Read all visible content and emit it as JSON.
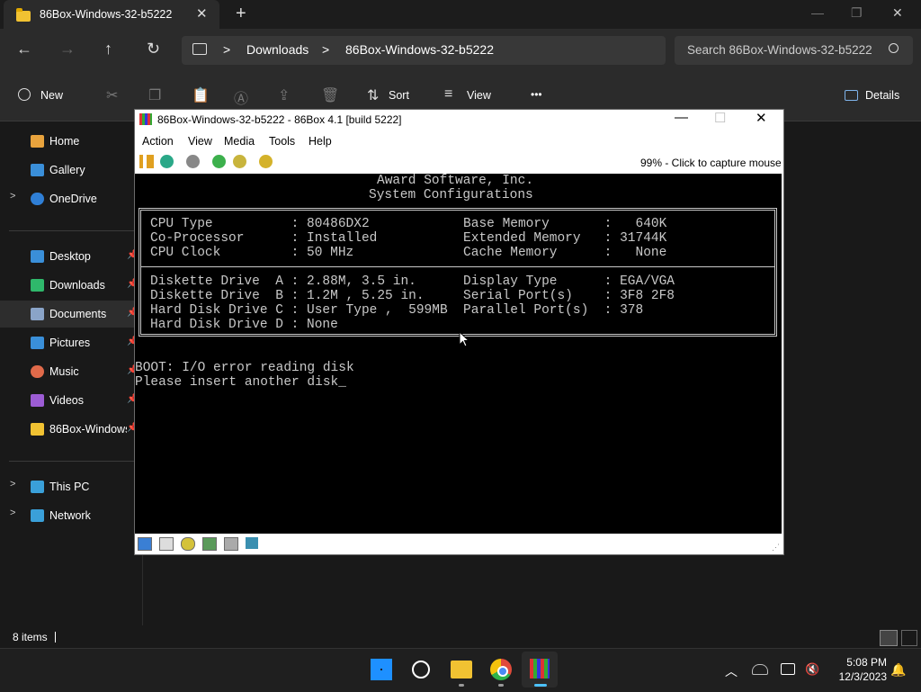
{
  "explorer": {
    "tab_title": "86Box-Windows-32-b5222",
    "tab_close": "✕",
    "new_tab": "+",
    "window_controls": {
      "minimize": "—",
      "maximize": "❐",
      "close": "✕"
    },
    "nav": {
      "back": "←",
      "forward": "→",
      "up": "↑",
      "refresh": "↻"
    },
    "breadcrumb": [
      "Downloads",
      "86Box-Windows-32-b5222"
    ],
    "breadcrumb_sep": ">",
    "search_placeholder": "Search 86Box-Windows-32-b5222",
    "commands": {
      "new": "New",
      "sort": "Sort",
      "view": "View",
      "more": "•••",
      "details": "Details"
    },
    "sidebar": {
      "items": [
        {
          "label": "Home",
          "icon": "home-icon",
          "color": "#e8a33d"
        },
        {
          "label": "Gallery",
          "icon": "gallery-icon",
          "color": "#3a8fd9"
        },
        {
          "label": "OneDrive",
          "icon": "cloud-icon",
          "color": "#2f7fd6"
        },
        {
          "label": "Desktop",
          "icon": "desktop-icon",
          "color": "#3a8fd9"
        },
        {
          "label": "Downloads",
          "icon": "download-icon",
          "color": "#2fb86b"
        },
        {
          "label": "Documents",
          "icon": "document-icon",
          "color": "#8aa4c8"
        },
        {
          "label": "Pictures",
          "icon": "pictures-icon",
          "color": "#3a8fd9"
        },
        {
          "label": "Music",
          "icon": "music-icon",
          "color": "#e06a4a"
        },
        {
          "label": "Videos",
          "icon": "videos-icon",
          "color": "#9c5cd4"
        },
        {
          "label": "86Box-Windows",
          "icon": "folder-icon",
          "color": "#f1c232"
        },
        {
          "label": "This PC",
          "icon": "pc-icon",
          "color": "#3aa0d9"
        },
        {
          "label": "Network",
          "icon": "network-icon",
          "color": "#3aa0d9"
        }
      ]
    },
    "status_items": "8 items"
  },
  "box86": {
    "title": "86Box-Windows-32-b5222 - 86Box 4.1 [build 5222]",
    "menu": [
      "Action",
      "View",
      "Media",
      "Tools",
      "Help"
    ],
    "capture_text": "99% - Click to capture mouse",
    "screen": {
      "header1": "Award Software, Inc.",
      "header2": "System Configurations",
      "rows_top": [
        "CPU Type          : 80486DX2            Base Memory       :   640K",
        "Co-Processor      : Installed           Extended Memory   : 31744K",
        "CPU Clock         : 50 MHz              Cache Memory      :   None"
      ],
      "rows_bottom": [
        "Diskette Drive  A : 2.88M, 3.5 in.      Display Type      : EGA/VGA",
        "Diskette Drive  B : 1.2M , 5.25 in.     Serial Port(s)    : 3F8 2F8",
        "Hard Disk Drive C : User Type ,  599MB  Parallel Port(s)  : 378",
        "Hard Disk Drive D : None"
      ],
      "boot_line1": "BOOT: I/O error reading disk",
      "boot_line2": "Please insert another disk_"
    }
  },
  "taskbar": {
    "time": "5:08 PM",
    "date": "12/3/2023"
  }
}
